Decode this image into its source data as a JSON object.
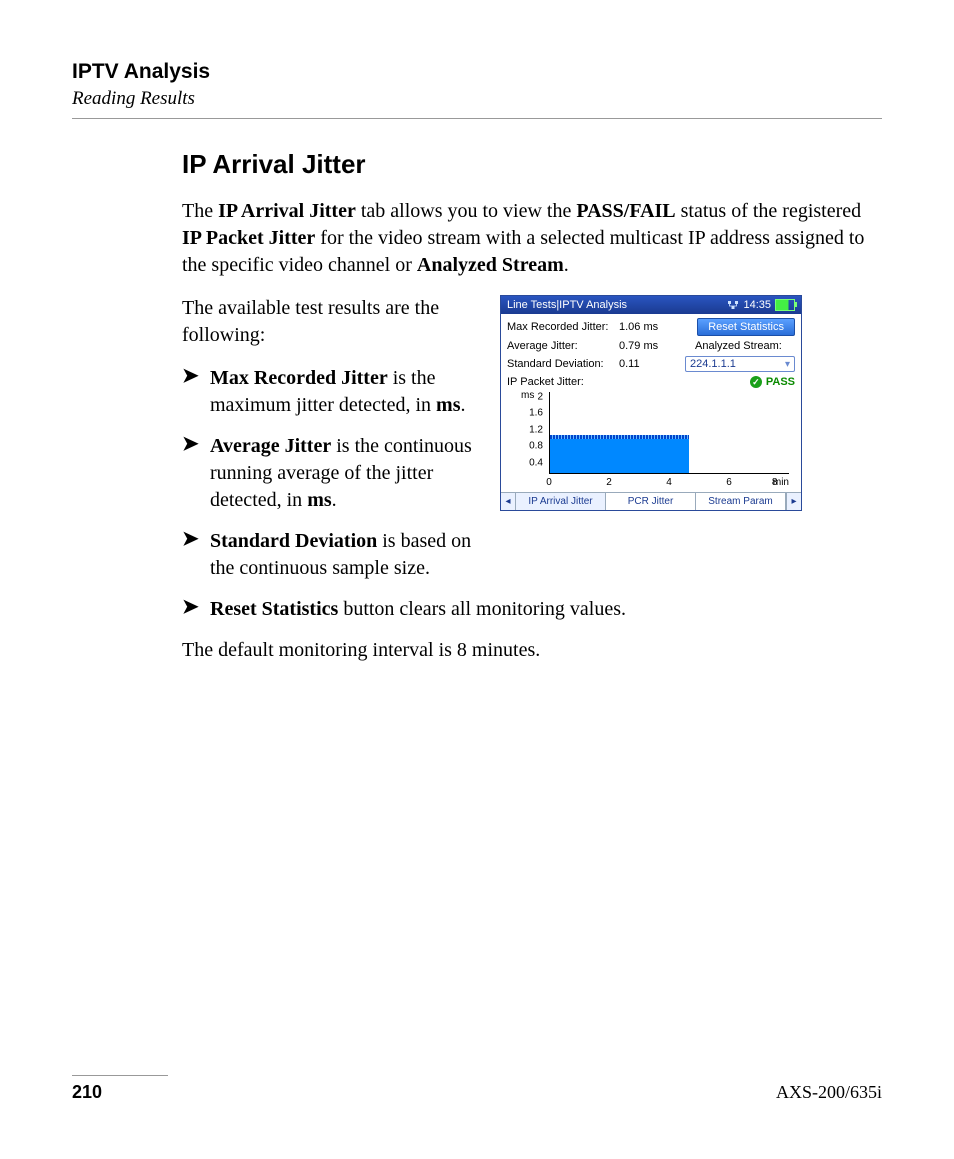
{
  "header": {
    "title": "IPTV Analysis",
    "subtitle": "Reading Results"
  },
  "section_title": "IP Arrival Jitter",
  "intro": {
    "pre1": "The ",
    "b1": "IP Arrival Jitter",
    "mid1": " tab allows you to view the ",
    "b2": "PASS/FAIL",
    "mid2": " status of the registered ",
    "b3": "IP Packet Jitter",
    "mid3": " for the video stream with a selected multicast IP address assigned to the specific video channel or ",
    "b4": "Analyzed Stream",
    "end": "."
  },
  "lead": "The available test results are the following:",
  "bullets": [
    {
      "b": "Max Recorded Jitter",
      "t1": " is the maximum jitter detected, in ",
      "u": "ms",
      "t2": "."
    },
    {
      "b": "Average Jitter",
      "t1": " is the continuous running average of the jitter detected, in ",
      "u": "ms",
      "t2": "."
    },
    {
      "b": "Standard Deviation",
      "t1": " is based on the continuous sample size.",
      "u": "",
      "t2": ""
    },
    {
      "b": "Reset Statistics",
      "t1": " button clears all monitoring values.",
      "u": "",
      "t2": ""
    }
  ],
  "closing": "The default monitoring interval is 8 minutes.",
  "screenshot": {
    "title": "Line Tests|IPTV Analysis",
    "clock": "14:35",
    "max_label": "Max Recorded Jitter:",
    "max_val": "1.06 ms",
    "avg_label": "Average Jitter:",
    "avg_val": "0.79 ms",
    "sd_label": "Standard Deviation:",
    "sd_val": "0.11",
    "reset": "Reset Statistics",
    "as_label": "Analyzed Stream:",
    "stream": "224.1.1.1",
    "pkt_label": "IP Packet Jitter:",
    "pass": "PASS",
    "yunit": "ms",
    "xunit": "min",
    "tabs": {
      "a": "IP Arrival Jitter",
      "b": "PCR Jitter",
      "c": "Stream Param"
    }
  },
  "chart_data": {
    "type": "area",
    "title": "IP Packet Jitter",
    "xlabel": "min",
    "ylabel": "ms",
    "xlim": [
      0,
      8
    ],
    "ylim": [
      0,
      2.0
    ],
    "xticks": [
      0,
      2,
      4,
      6,
      8
    ],
    "yticks": [
      0.4,
      0.8,
      1.2,
      1.6,
      2.0
    ],
    "series": [
      {
        "name": "IP Packet Jitter",
        "x": [
          0.0,
          0.5,
          1.0,
          1.5,
          2.0,
          2.5,
          3.0,
          3.5,
          4.0,
          4.5
        ],
        "values": [
          0.8,
          0.85,
          0.82,
          0.9,
          0.84,
          0.88,
          0.8,
          0.86,
          0.83,
          0.85
        ]
      }
    ]
  },
  "footer": {
    "page": "210",
    "model": "AXS-200/635i"
  }
}
